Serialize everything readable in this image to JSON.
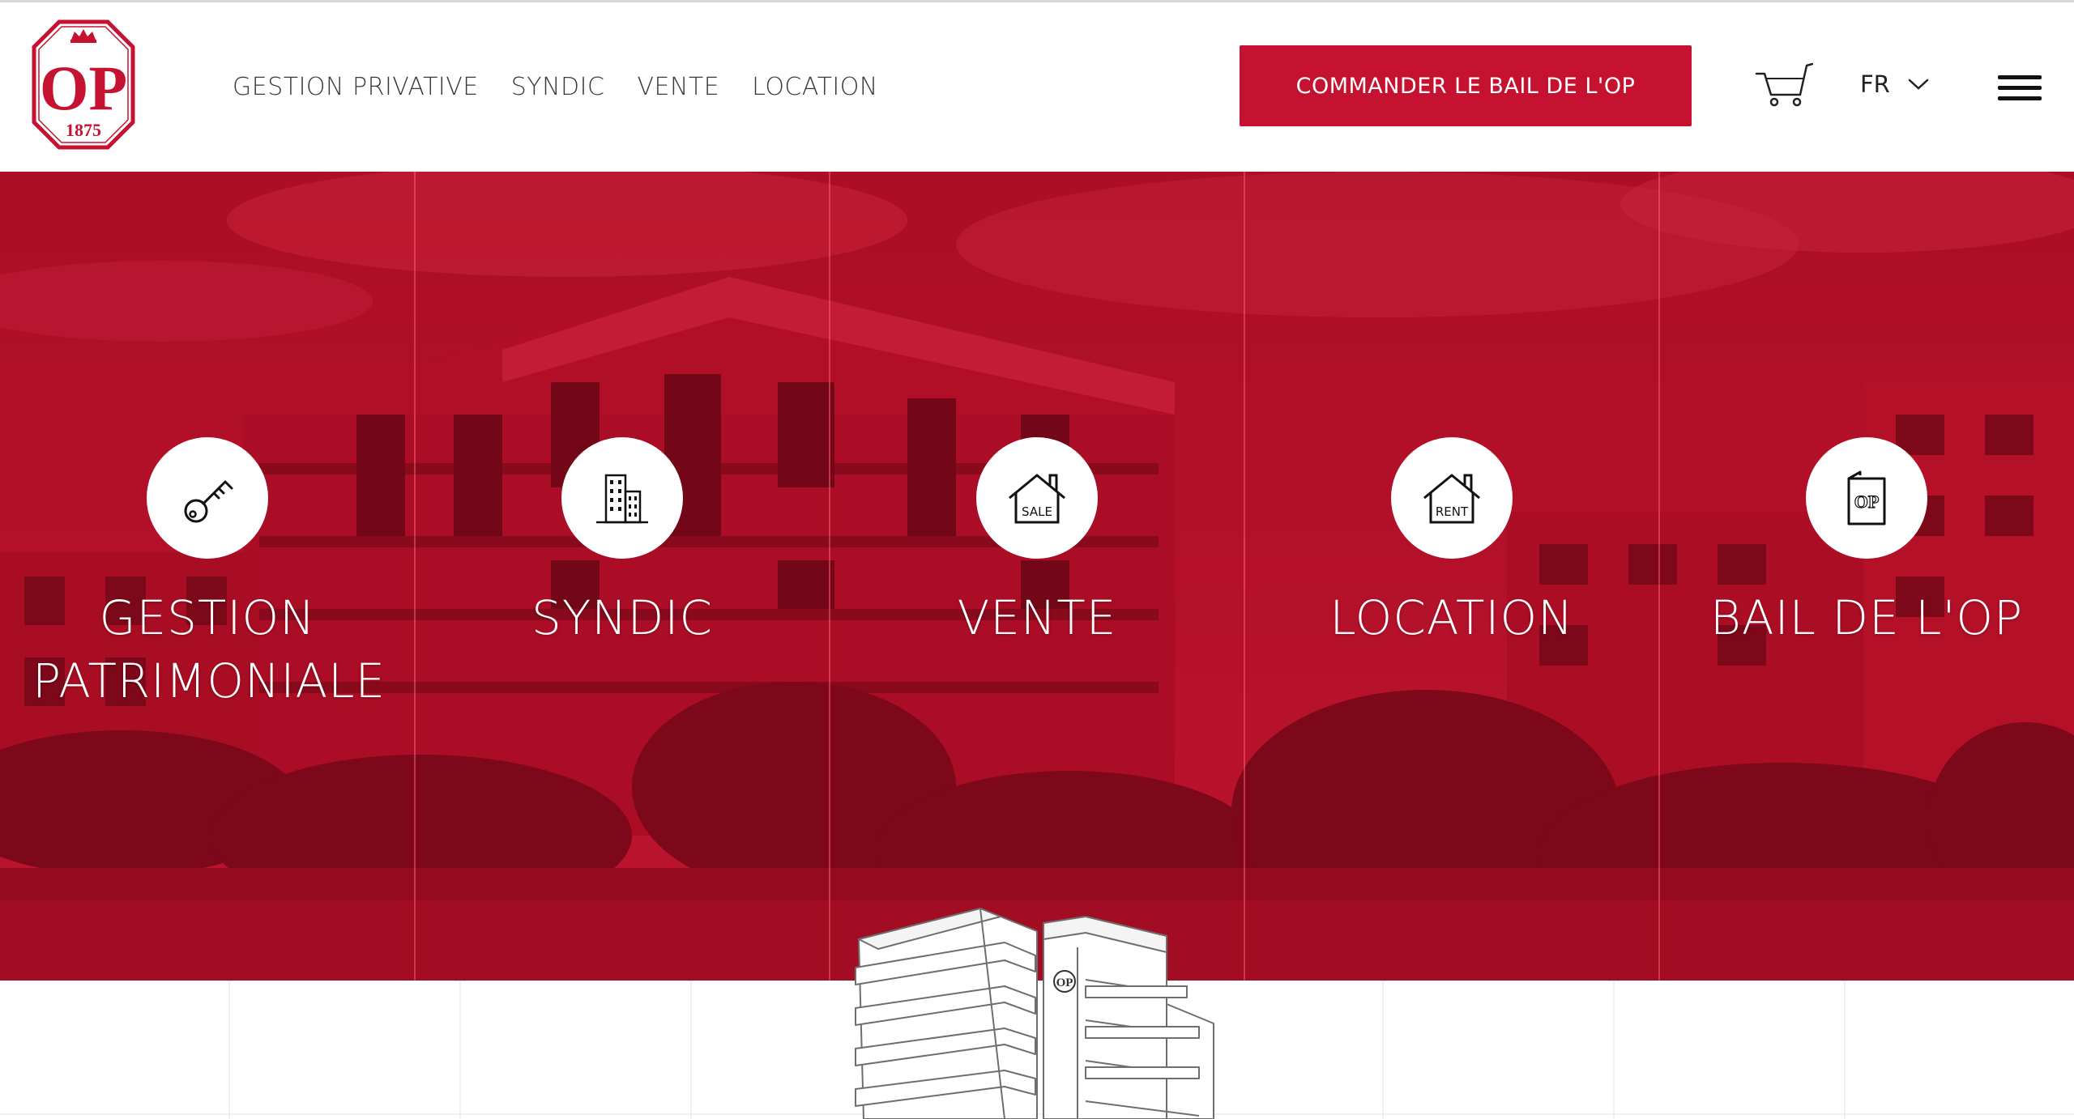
{
  "brand": {
    "logo_letters": "OP",
    "logo_year": "1875",
    "color": "#c51230"
  },
  "nav": {
    "items": [
      {
        "label": "GESTION PRIVATIVE"
      },
      {
        "label": "SYNDIC"
      },
      {
        "label": "VENTE"
      },
      {
        "label": "LOCATION"
      }
    ]
  },
  "header": {
    "cta_label": "COMMANDER LE BAIL DE L'OP",
    "cart_icon": "cart-icon",
    "language": {
      "selected": "FR"
    },
    "menu_icon": "hamburger-icon"
  },
  "hero": {
    "tint_color": "#b50f27",
    "tiles": [
      {
        "label": "GESTION PATRIMONIALE",
        "icon": "key-icon"
      },
      {
        "label": "SYNDIC",
        "icon": "building-icon"
      },
      {
        "label": "VENTE",
        "icon": "house-sale-icon",
        "icon_text": "SALE"
      },
      {
        "label": "LOCATION",
        "icon": "house-rent-icon",
        "icon_text": "RENT"
      },
      {
        "label": "BAIL DE L'OP",
        "icon": "lease-document-icon",
        "icon_text": "OP"
      }
    ]
  },
  "bottom": {
    "building_badge": "OP"
  }
}
